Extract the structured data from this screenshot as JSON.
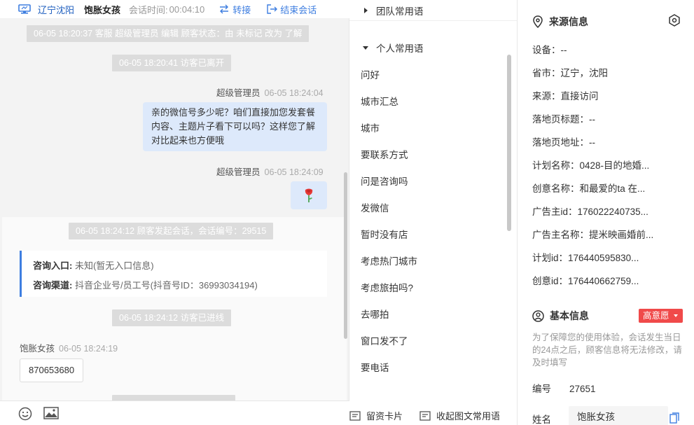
{
  "chat": {
    "header": {
      "location": "辽宁沈阳",
      "visitor_name": "饱胀女孩",
      "session_time_label": "会话时间:",
      "session_time": "00:04:10",
      "transfer_label": "转接",
      "end_label": "结束会话"
    },
    "messages": {
      "sys1": "06-05 18:20:37 客服 超级管理员 编辑 顾客状态：由 未标记 改为 了解",
      "sys2": "06-05 18:20:41 访客已离开",
      "agent1_name": "超级管理员",
      "agent1_time": "06-05 18:24:04",
      "agent1_line1": "亲的微信号多少呢？咱们直接加您发套餐",
      "agent1_line2": "内容、主题片子看下可以吗？这样您了解",
      "agent1_line3": "对比起来也方便哦",
      "agent2_name": "超级管理员",
      "agent2_time": "06-05 18:24:09",
      "sys3": "06-05 18:24:12 顾客发起会话，会话编号：29515",
      "entry_label": "咨询入口:",
      "entry_value": "未知(暂无入口信息)",
      "channel_label": "咨询渠道:",
      "channel_value": "抖音企业号/员工号(抖音号ID：36993034194)",
      "sys4": "06-05 18:24:12 访客已进线",
      "visitor_name": "饱胀女孩",
      "visitor_time": "06-05 18:24:19",
      "visitor_msg": "870653680"
    },
    "toolbar": {
      "emoji_icon": "smile-icon",
      "image_icon": "image-icon"
    }
  },
  "phrases": {
    "team_group": "团队常用语",
    "my_group": "个人常用语",
    "items": [
      "问好",
      "城市汇总",
      "城市",
      "要联系方式",
      "问是咨询吗",
      "发微信",
      "暂时没有店",
      "考虑热门城市",
      "考虑旅拍吗?",
      "去哪拍",
      "窗口发不了",
      "要电话"
    ],
    "footer": {
      "leave_card": "留资卡片",
      "collapse": "收起图文常用语"
    }
  },
  "info": {
    "source_title": "来源信息",
    "fields": [
      "设备：--",
      "省市：辽宁，沈阳",
      "来源：直接访问",
      "落地页标题：--",
      "落地页地址：--",
      "计划名称：0428-目的地婚...",
      "创意名称：和最爱的ta 在...",
      "广告主id：176022240735...",
      "广告主名称：提米映画婚前...",
      "计划id：176440595830...",
      "创意id：176440662759..."
    ],
    "basic_title": "基本信息",
    "intent_badge": "高意愿",
    "notice": "为了保障您的使用体验，会话发生当日的24点之后，顾客信息将无法修改，请及时填写",
    "id_label": "编号",
    "id_value": "27651",
    "name_label": "姓名",
    "name_value": "饱胀女孩"
  },
  "colors": {
    "accent": "#3e7ee0",
    "agent_bubble": "#dde9fb",
    "badge": "#f04a4a"
  }
}
